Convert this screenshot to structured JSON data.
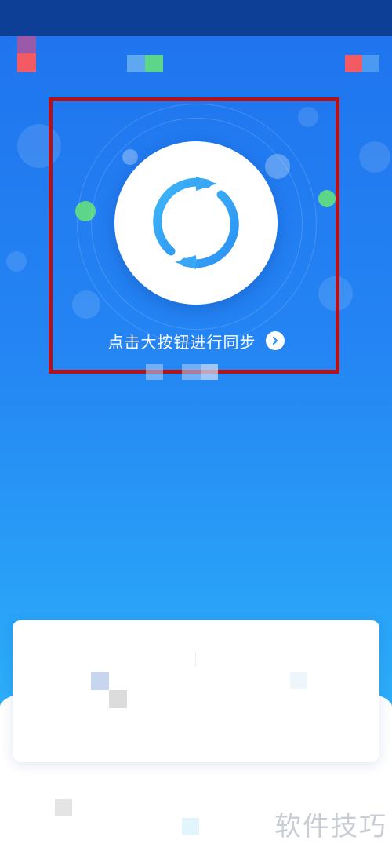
{
  "status_bar": {},
  "sync": {
    "hint_text": "点击大按钮进行同步"
  },
  "watermark": {
    "text": "软件技巧"
  },
  "colors": {
    "accent_blue": "#2a8ff5",
    "highlight_red": "#b3121a",
    "green_dot": "#5ed68a"
  },
  "icons": {
    "sync": "sync-icon",
    "chevron": "chevron-right-icon"
  }
}
